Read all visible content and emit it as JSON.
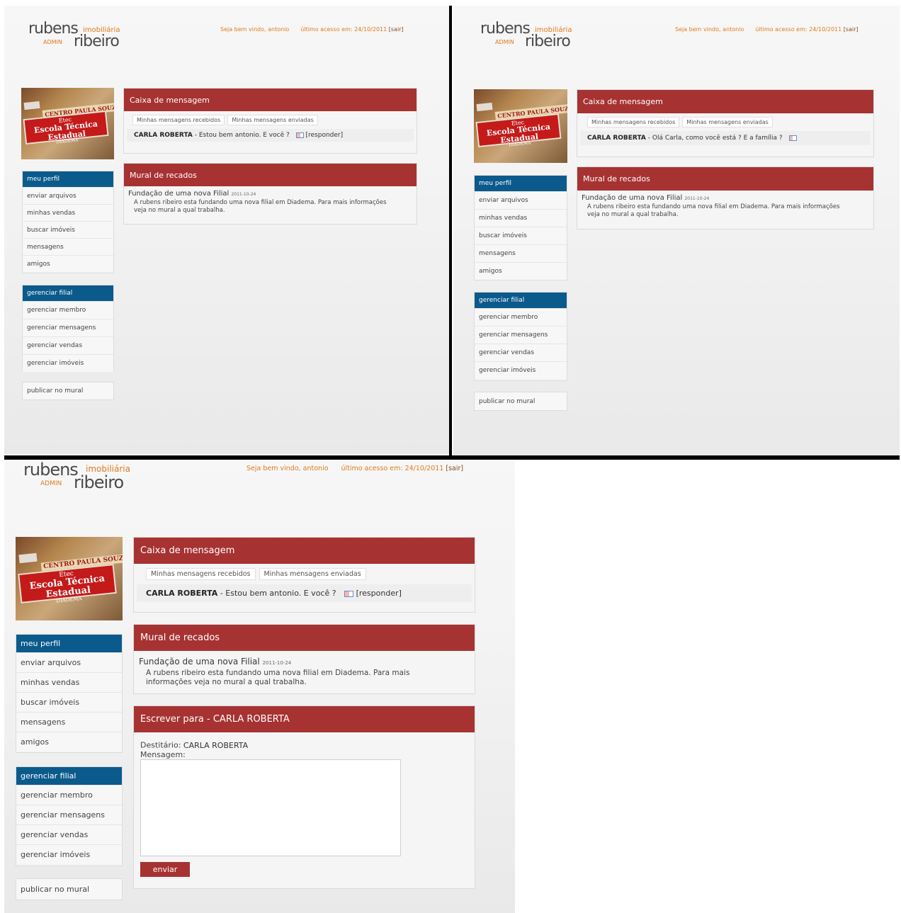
{
  "logo": {
    "brand_first": "rubens",
    "brand_second": "ribeiro",
    "sub": "imobiliária",
    "role": "ADMIN"
  },
  "header": {
    "welcome": "Seja bem vindo, antonio",
    "last_access": "último acesso em: 24/10/2011",
    "logout": "[sair]"
  },
  "photo": {
    "sign_line1": "Etec",
    "sign_line2": "Escola Técnica Estadual",
    "sign_line3": "DIADEMA",
    "banner": "CENTRO PAULA SOUZA"
  },
  "menu_profile": {
    "title": "meu perfil",
    "items": [
      "enviar arquivos",
      "minhas vendas",
      "buscar imóveis",
      "mensagens",
      "amigos"
    ]
  },
  "menu_manage": {
    "title": "gerenciar filial",
    "items": [
      "gerenciar membro",
      "gerenciar mensagens",
      "gerenciar vendas",
      "gerenciar imóveis"
    ]
  },
  "publish": "publicar no mural",
  "inbox": {
    "title": "Caixa de mensagem",
    "tab_received": "Minhas mensagens recebidos",
    "tab_sent": "Minhas mensagens enviadas",
    "sender": "CARLA ROBERTA",
    "separator": "-",
    "reply": "[responder]"
  },
  "messages": {
    "screen1": "Estou bem antonio. E você ?",
    "screen2": "Olá Carla, como você está ? E a família ?",
    "screen3": "Estou bem antonio. E você ?"
  },
  "mural": {
    "title": "Mural de recados",
    "post_title": "Fundação de uma nova Filial",
    "post_date": "2011-10-24",
    "post_text": "A rubens ribeiro esta fundando uma nova filial em Diadema. Para mais informações veja no mural a qual trabalha."
  },
  "compose": {
    "title": "Escrever para -  CARLA ROBERTA",
    "to_label": "Destitário:",
    "to_value": "CARLA ROBERTA",
    "message_label": "Mensagem:",
    "message_value": "",
    "send": "enviar"
  },
  "colors": {
    "header_red": "#a73232",
    "menu_blue": "#0b5a8c",
    "accent_orange": "#e07a1e"
  }
}
